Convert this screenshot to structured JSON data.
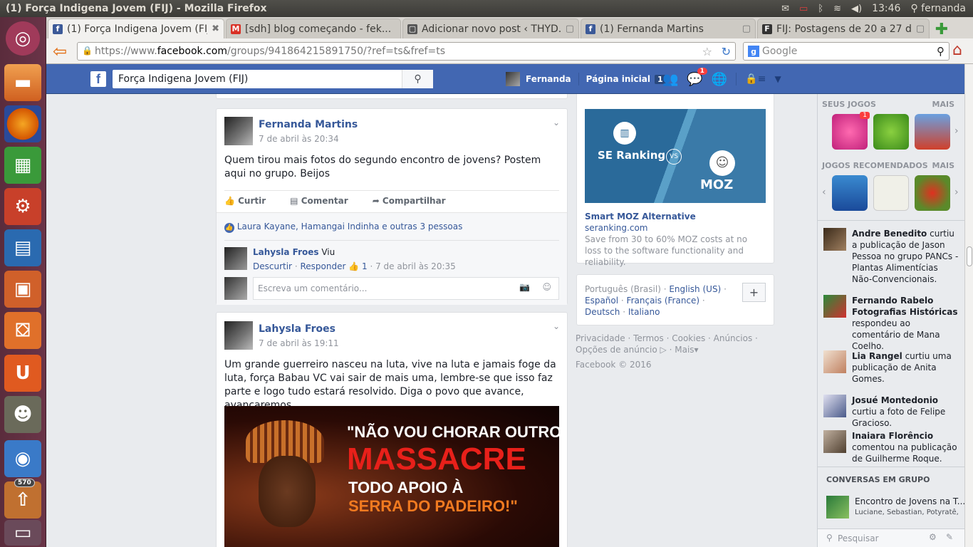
{
  "window": {
    "title": "(1) Força Indigena Jovem (FIJ) - Mozilla Firefox",
    "clock": "13:46",
    "user": "fernanda"
  },
  "launcher": {
    "badge": "570"
  },
  "tabs": [
    {
      "label": "(1) Força Indigena Jovem (FIJ)",
      "color": "#3b5998",
      "glyph": "f"
    },
    {
      "label": "[sdh] blog começando - fek...",
      "color": "#d93025",
      "glyph": "M"
    },
    {
      "label": "Adicionar novo post ‹ THYD...",
      "color": "#555555",
      "glyph": "W"
    },
    {
      "label": "(1) Fernanda Martins",
      "color": "#3b5998",
      "glyph": "f"
    },
    {
      "label": "FIJ: Postagens de 20 a 27 de...",
      "color": "#333333",
      "glyph": "F"
    }
  ],
  "urlbar": {
    "prefix": "https://www.",
    "domain": "facebook.com",
    "path": "/groups/941864215891750/?ref=ts&fref=ts"
  },
  "searchbar": {
    "placeholder": "Google"
  },
  "fb": {
    "search_value": "Força Indigena Jovem (FIJ)",
    "user": "Fernanda",
    "home": "Página inicial",
    "home_count": "1",
    "notif_count": "1"
  },
  "post1": {
    "author": "Fernanda Martins",
    "time": "7 de abril às 20:34",
    "text": "Quem tirou mais fotos do segundo encontro de jovens? Postem aqui no grupo. Beijos",
    "like": "Curtir",
    "comment": "Comentar",
    "share": "Compartilhar",
    "likes": "Laura Kayane, Hamangai Indinha e outras 3 pessoas",
    "reply_author": "Lahysla Froes",
    "reply_text": "Viu",
    "reply_unlike": "Descurtir",
    "reply_respond": "Responder",
    "reply_likes": "1",
    "reply_time": "7 de abril às 20:35",
    "comment_placeholder": "Escreva um comentário..."
  },
  "post2": {
    "author": "Lahysla Froes",
    "time": "7 de abril às 19:11",
    "text": "Um grande guerreiro nasceu na luta, vive na luta e jamais foge da luta, força Babau VC vai sair de mais uma, lembre-se que isso faz parte e logo tudo estará resolvido. Diga o povo que avance, avançaremos",
    "image_line1": "\"NÃO VOU CHORAR OUTRO",
    "image_line2": "MASSACRE",
    "image_line3": "TODO APOIO À",
    "image_line4": "SERRA DO PADEIRO!\""
  },
  "ad": {
    "left_brand": "SE Ranking",
    "vs": "VS",
    "right_brand": "MOZ",
    "title": "Smart MOZ Alternative",
    "domain": "seranking.com",
    "desc": "Save from 30 to 60% MOZ costs at no loss to the software functionality and reliability."
  },
  "languages": {
    "current": "Português (Brasil)",
    "l1": "English (US)",
    "l2": "Español",
    "l3": "Français (France)",
    "l4": "Deutsch",
    "l5": "Italiano",
    "add": "+"
  },
  "footer": {
    "links": "Privacidade · Termos · Cookies · Anúncios · Opções de anúncio",
    "more": "Mais",
    "copyright": "Facebook © 2016"
  },
  "sidebar": {
    "games_title": "SEUS JOGOS",
    "more": "MAIS",
    "games_badge": "1",
    "rec_title": "JOGOS RECOMENDADOS",
    "ticker": [
      {
        "name": "Andre Benedito",
        "text": " curtiu a publicação de Jason Pessoa no grupo PANCs - Plantas Alimentícias Não-Convencionais."
      },
      {
        "name": "Fernando Rabelo Fotografias Históricas",
        "text": " respondeu ao comentário de Mana Coelho."
      },
      {
        "name": "Lia Rangel",
        "text": " curtiu uma publicação de Anita Gomes."
      },
      {
        "name": "Josué Montedonio",
        "text": " curtiu a foto de Felipe Gracioso."
      },
      {
        "name": "Inaiara Florêncio",
        "text": " comentou na publicação de Guilherme Roque."
      }
    ],
    "group_chats_title": "CONVERSAS EM GRUPO",
    "chat_name": "Encontro de Jovens na T...",
    "chat_members": "Luciane, Sebastian, Potyratê, ...",
    "chat_search": "Pesquisar"
  }
}
